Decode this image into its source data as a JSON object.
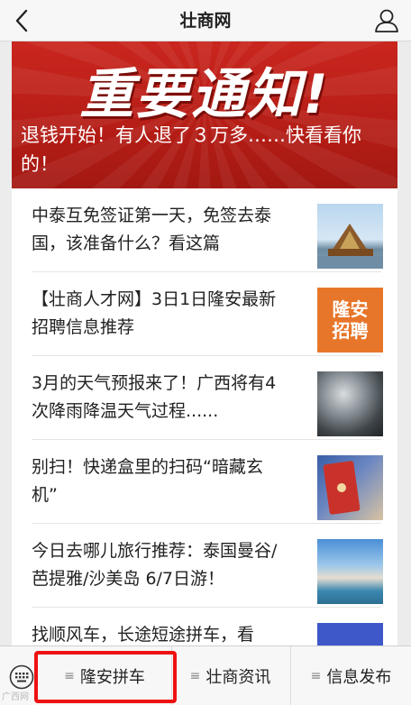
{
  "nav": {
    "title": "壮商网"
  },
  "banner": {
    "heading": "重要通知!",
    "subtitle": "退钱开始！有人退了３万多……快看看你的！"
  },
  "articles": [
    {
      "title": "中泰互免签证第一天，免签去泰国，该准备什么？看这篇",
      "thumb_icon": "temple-thumbnail"
    },
    {
      "title": "【壮商人才网】3日1日隆安最新招聘信息推荐",
      "thumb_icon": "recruit-thumbnail",
      "thumb_text": [
        "隆安",
        "招聘"
      ]
    },
    {
      "title": "3月的天气预报来了！广西将有4次降雨降温天气过程......",
      "thumb_icon": "weather-thumbnail"
    },
    {
      "title": "别扫！快递盒里的扫码“暗藏玄机”",
      "thumb_icon": "parcel-thumbnail"
    },
    {
      "title": "今日去哪儿旅行推荐：泰国曼谷/芭提雅/沙美岛 6/7日游！",
      "thumb_icon": "beach-thumbnail"
    },
    {
      "title": "找顺风车，长途短途拼车，看",
      "thumb_icon": "travel-thumbnail"
    }
  ],
  "menu": {
    "items": [
      "隆安拼车",
      "壮商资讯",
      "信息发布"
    ],
    "lines_glyph": "≡"
  },
  "watermark": "广西网",
  "colors": {
    "banner_red": "#c9261e",
    "highlight": "#ee1111",
    "recruit_orange": "#e7762a"
  }
}
